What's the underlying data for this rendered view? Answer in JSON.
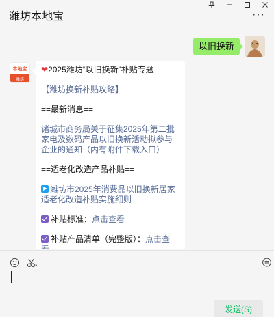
{
  "window": {
    "title": "潍坊本地宝",
    "controls": [
      "pin-icon",
      "minimize-icon",
      "maximize-icon",
      "close-icon"
    ],
    "more_label": "···"
  },
  "messages": {
    "outgoing": {
      "text": "以旧换新"
    },
    "incoming_avatar": {
      "top_text": "本地宝",
      "bottom_text": "潍坊"
    },
    "article": {
      "heart": "❤",
      "title": "2025潍坊“以旧换新”补贴专题",
      "guide_link": "【潍坊换新补贴攻略】",
      "section_latest": "==最新消息==",
      "notice_link": "诸城市商务局关于征集2025年第二批家电及数码产品以旧换新活动拟参与企业的通知（内有附件下载入口）",
      "section_aging": "==适老化改造产品补贴==",
      "aging_link": "潍坊市2025年消费品以旧换新居家适老化改造补贴实施细则",
      "standard_label": "补贴标准：",
      "standard_link": "点击查看",
      "list_label": "补贴产品清单（完整版）：",
      "list_link": "点击查看"
    }
  },
  "composer": {
    "tools": [
      "emoji-icon",
      "scissors-icon",
      "chat-history-icon"
    ],
    "send_label": "发送(S)"
  },
  "colors": {
    "bubble_me": "#95ec69",
    "link": "#576b95",
    "send_text": "#07c160",
    "brand": "#e8502c"
  }
}
